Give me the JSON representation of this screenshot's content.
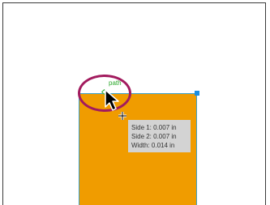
{
  "canvas": {
    "hint_label": "path",
    "measurement_tooltip": {
      "lines": [
        "Side 1: 0.007 in",
        "Side 2: 0.007 in",
        "Width:  0.014 in"
      ]
    }
  },
  "colors": {
    "shape_fill": "#f09c00",
    "shape_stroke": "#3aa0c8",
    "selection_handle": "#1a8ee0",
    "smart_guide": "#2aa82a",
    "highlight_ellipse": "#a21b5e",
    "tooltip_bg": "#d3d3d3"
  },
  "icons": {
    "pointer": "arrow-cursor-icon",
    "crosshair": "crosshair-plus-icon",
    "anchor": "diamond-anchor-icon"
  }
}
